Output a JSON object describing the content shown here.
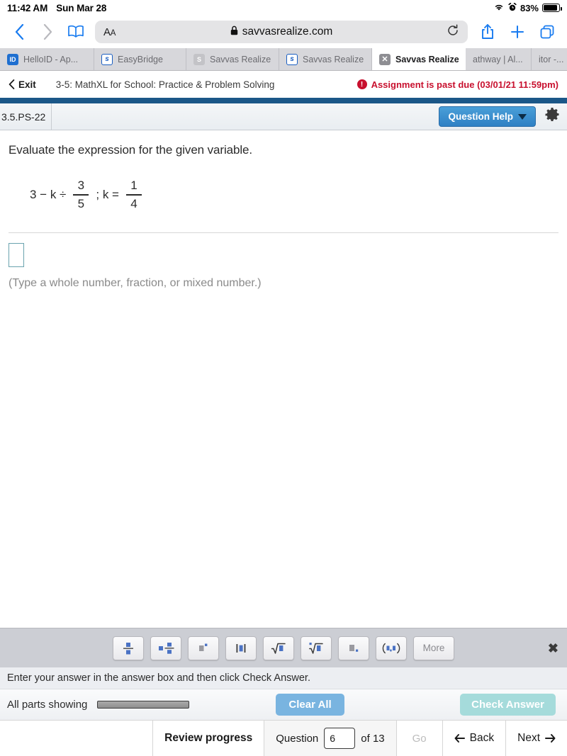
{
  "statusbar": {
    "time": "11:42 AM",
    "date": "Sun Mar 28",
    "wifi_icon": "wifi-icon",
    "alarm_icon": "alarm-icon",
    "battery_percent": "83%",
    "battery_icon": "battery-icon"
  },
  "browser": {
    "back_icon": "chevron-left-icon",
    "forward_icon": "chevron-right-icon",
    "bookmarks_icon": "book-icon",
    "reader_label": "ᴀA",
    "lock_icon": "lock-icon",
    "url": "savvasrealize.com",
    "reload_icon": "reload-icon",
    "share_icon": "share-icon",
    "newtab_icon": "plus-icon",
    "tabs_icon": "tabs-icon",
    "tabs": [
      {
        "label": "HelloID - Ap...",
        "favicon": "helloid-icon",
        "favicon_text": "ID",
        "active": false
      },
      {
        "label": "EasyBridge",
        "favicon": "savvas-icon",
        "favicon_text": "s",
        "active": false
      },
      {
        "label": "Savvas Realize",
        "favicon": "savvas-gray-icon",
        "favicon_text": "S",
        "active": false
      },
      {
        "label": "Savvas Realize",
        "favicon": "savvas-icon",
        "favicon_text": "s",
        "active": false
      },
      {
        "label": "Savvas Realize",
        "favicon": "close-icon",
        "favicon_text": "✕",
        "active": true
      },
      {
        "label": "athway | Al...",
        "favicon": "",
        "favicon_text": "",
        "active": false
      },
      {
        "label": "itor -...",
        "favicon": "",
        "favicon_text": "",
        "active": false
      }
    ]
  },
  "app_header": {
    "exit_label": "Exit",
    "exit_icon": "chevron-left-icon",
    "lesson_title": "3-5: MathXL for School: Practice & Problem Solving",
    "past_due_text": "Assignment is past due (03/01/21 11:59pm)",
    "past_due_icon": "alert-icon",
    "past_due_color": "#c8102e",
    "accent_bar_color": "#1b5788"
  },
  "question_toolbar": {
    "question_id": "3.5.PS-22",
    "help_label": "Question Help",
    "help_caret_icon": "caret-down-icon",
    "settings_icon": "gear-icon",
    "help_button_color": "#2f80c4"
  },
  "question": {
    "prompt": "Evaluate the expression for the given variable.",
    "expression": {
      "lead": "3 − k ÷",
      "fraction1": {
        "numerator": "3",
        "denominator": "5"
      },
      "middle": "; k =",
      "fraction2": {
        "numerator": "1",
        "denominator": "4"
      }
    },
    "answer_value": "",
    "answer_hint": "(Type a whole number, fraction, or mixed number.)",
    "answer_box_color": "#6aa3ae"
  },
  "math_palette": {
    "close_icon": "close-icon",
    "buttons": [
      {
        "name": "fraction-button",
        "glyph": "fraction-icon"
      },
      {
        "name": "mixed-number-button",
        "glyph": "mixed-number-icon"
      },
      {
        "name": "exponent-button",
        "glyph": "exponent-icon"
      },
      {
        "name": "absolute-value-button",
        "glyph": "absolute-value-icon"
      },
      {
        "name": "square-root-button",
        "glyph": "square-root-icon"
      },
      {
        "name": "nth-root-button",
        "glyph": "nth-root-icon"
      },
      {
        "name": "decimal-button",
        "glyph": "decimal-icon"
      },
      {
        "name": "ordered-pair-button",
        "glyph": "ordered-pair-icon"
      }
    ],
    "more_label": "More"
  },
  "instruction": "Enter your answer in the answer box and then click Check Answer.",
  "actions": {
    "all_parts_label": "All parts showing",
    "slider_name": "parts-slider",
    "clear_all_label": "Clear All",
    "clear_all_color": "#79b4e0",
    "check_answer_label": "Check Answer",
    "check_answer_color": "#a5dbdb"
  },
  "bottom_nav": {
    "review_progress_label": "Review progress",
    "question_label": "Question",
    "question_number": "6",
    "of_label": "of 13",
    "go_label": "Go",
    "back_label": "Back",
    "back_icon": "arrow-left-icon",
    "next_label": "Next",
    "next_icon": "arrow-right-icon"
  }
}
